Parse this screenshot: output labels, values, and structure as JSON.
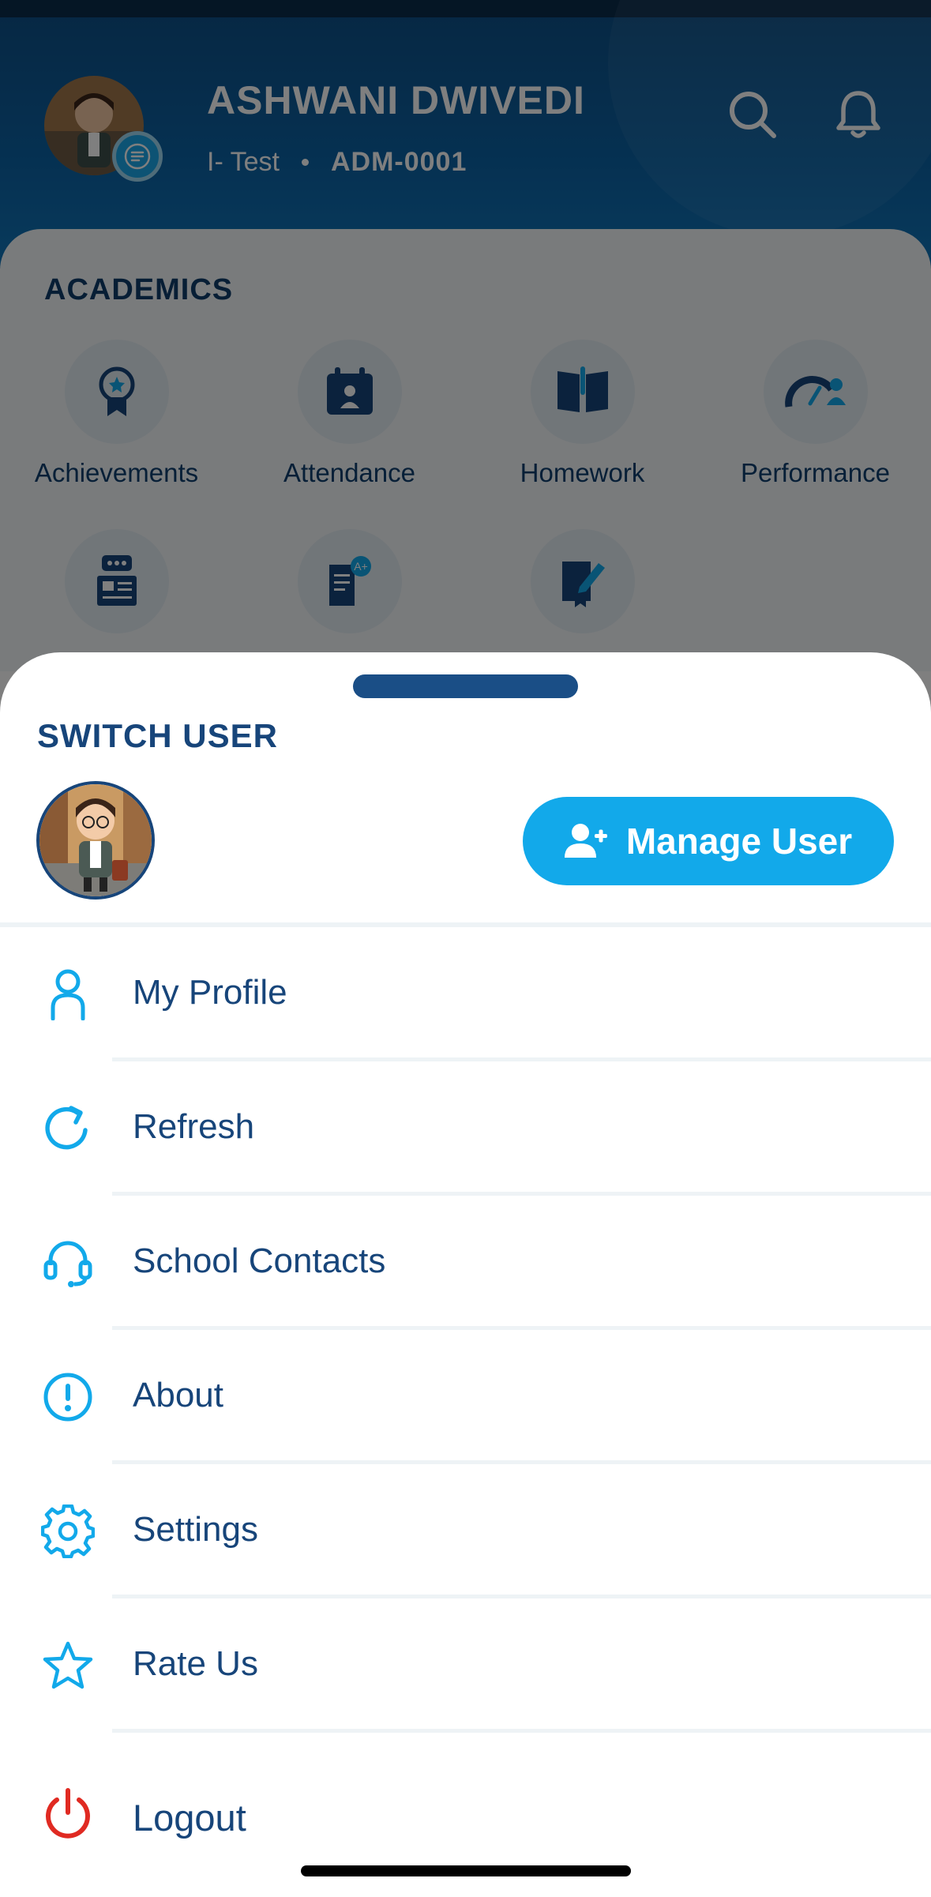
{
  "header": {
    "student_name": "ASHWANI DWIVEDI",
    "class_label": "I- Test",
    "admission_no": "ADM-0001",
    "search_icon": "search-icon",
    "notification_icon": "bell-icon"
  },
  "academics": {
    "title": "ACADEMICS",
    "items": [
      {
        "label": "Achievements",
        "icon": "award-icon"
      },
      {
        "label": "Attendance",
        "icon": "calendar-icon"
      },
      {
        "label": "Homework",
        "icon": "book-icon"
      },
      {
        "label": "Performance",
        "icon": "gauge-icon"
      }
    ]
  },
  "switch_user": {
    "title": "SWITCH USER",
    "manage_button_label": "Manage User"
  },
  "menu": {
    "items": [
      {
        "label": "My Profile",
        "icon": "user-icon"
      },
      {
        "label": "Refresh",
        "icon": "refresh-icon"
      },
      {
        "label": "School Contacts",
        "icon": "headset-icon"
      },
      {
        "label": "About",
        "icon": "info-icon"
      },
      {
        "label": "Settings",
        "icon": "gear-icon"
      },
      {
        "label": "Rate Us",
        "icon": "star-icon"
      },
      {
        "label": "Logout",
        "icon": "power-icon"
      }
    ]
  },
  "colors": {
    "primary_blue": "#12a9ea",
    "navy_text": "#17457a",
    "logout_red": "#e02a22"
  }
}
